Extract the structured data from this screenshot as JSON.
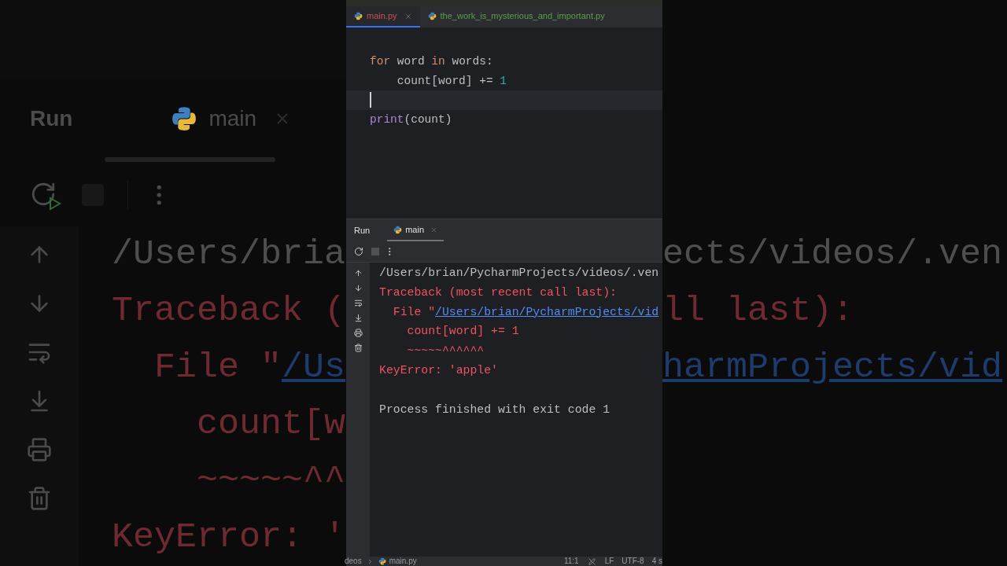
{
  "backdrop": {
    "run_label": "Run",
    "tab_label": "main",
    "left_lines": [
      {
        "segments": [
          {
            "kind": "plain",
            "text": "/Users/bria"
          }
        ]
      },
      {
        "segments": [
          {
            "kind": "error",
            "text": "Traceback ("
          }
        ]
      },
      {
        "segments": [
          {
            "kind": "error",
            "text": "  File \""
          },
          {
            "kind": "link",
            "text": "/Us"
          }
        ]
      },
      {
        "segments": [
          {
            "kind": "error",
            "text": "    count[w"
          }
        ]
      },
      {
        "segments": [
          {
            "kind": "error",
            "text": "    ~~~~~^^"
          }
        ]
      },
      {
        "segments": [
          {
            "kind": "error",
            "text": "KeyError: '"
          }
        ]
      }
    ],
    "right_lines": [
      {
        "segments": [
          {
            "kind": "plain",
            "text": "ects/videos/.ven"
          }
        ]
      },
      {
        "segments": [
          {
            "kind": "error",
            "text": "ll last):"
          }
        ]
      },
      {
        "segments": [
          {
            "kind": "link",
            "text": "harmProjects/vid"
          }
        ]
      }
    ]
  },
  "editor": {
    "tabs": [
      {
        "label": "main.py",
        "selected": true,
        "color": "#c75450"
      },
      {
        "label": "the_work_is_mysterious_and_important.py",
        "selected": false,
        "color": "#5f9e4c"
      }
    ],
    "lines": [
      {
        "current": false,
        "segments": [
          {
            "kind": "keyword",
            "text": "for"
          },
          {
            "kind": "plain",
            "text": " word "
          },
          {
            "kind": "keyword",
            "text": "in"
          },
          {
            "kind": "plain",
            "text": " words:"
          }
        ]
      },
      {
        "current": false,
        "segments": [
          {
            "kind": "plain",
            "text": "    count[word] += "
          },
          {
            "kind": "number",
            "text": "1"
          }
        ]
      },
      {
        "current": true
      },
      {
        "current": false,
        "segments": [
          {
            "kind": "builtin",
            "text": "print"
          },
          {
            "kind": "plain",
            "text": "(count)"
          }
        ]
      }
    ]
  },
  "run_panel": {
    "title": "Run",
    "tabs": [
      {
        "label": "main",
        "selected": true
      }
    ],
    "output": [
      {
        "segments": [
          {
            "kind": "plain",
            "text": "/Users/brian/PycharmProjects/videos/.ven"
          }
        ]
      },
      {
        "segments": [
          {
            "kind": "error",
            "text": "Traceback (most recent call last):"
          }
        ]
      },
      {
        "segments": [
          {
            "kind": "error",
            "text": "  File \""
          },
          {
            "kind": "link",
            "text": "/Users/brian/PycharmProjects/vid"
          }
        ]
      },
      {
        "segments": [
          {
            "kind": "error",
            "text": "    count[word] += 1"
          }
        ]
      },
      {
        "segments": [
          {
            "kind": "error",
            "text": "    ~~~~~^^^^^^"
          }
        ]
      },
      {
        "segments": [
          {
            "kind": "error",
            "text": "KeyError: 'apple'"
          }
        ]
      },
      {
        "kind": "status",
        "segments": [
          {
            "kind": "plain",
            "text": "Process finished with exit code 1"
          }
        ]
      }
    ]
  },
  "status_bar": {
    "path": "deos",
    "file": "main.py",
    "position": "11:1",
    "line_ending": "LF",
    "encoding": "UTF-8",
    "indent": "4 s"
  }
}
